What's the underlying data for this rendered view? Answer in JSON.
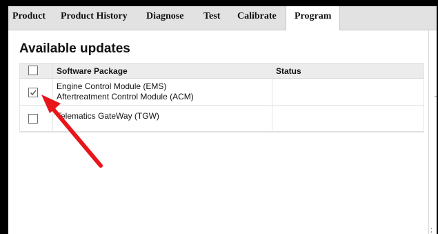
{
  "tabs": [
    {
      "label": "Product",
      "active": false
    },
    {
      "label": "Product History",
      "active": false
    },
    {
      "label": "Diagnose",
      "active": false
    },
    {
      "label": "Test",
      "active": false
    },
    {
      "label": "Calibrate",
      "active": false
    },
    {
      "label": "Program",
      "active": true
    }
  ],
  "page_title": "Available updates",
  "table": {
    "columns": [
      "",
      "Software Package",
      "Status"
    ],
    "rows": [
      {
        "checked": true,
        "packages": [
          "Engine Control Module (EMS)",
          "Aftertreatment Control Module (ACM)"
        ],
        "status": ""
      },
      {
        "checked": false,
        "packages": [
          "Telematics GateWay (TGW)"
        ],
        "status": ""
      }
    ]
  },
  "colors": {
    "annotation_arrow": "#e8151b",
    "active_tab": "#ffffff",
    "tab_bar": "#e2e2e2"
  },
  "icons": [
    "checkbox-checked-icon",
    "checkbox-empty-icon",
    "annotation-arrow-icon"
  ]
}
